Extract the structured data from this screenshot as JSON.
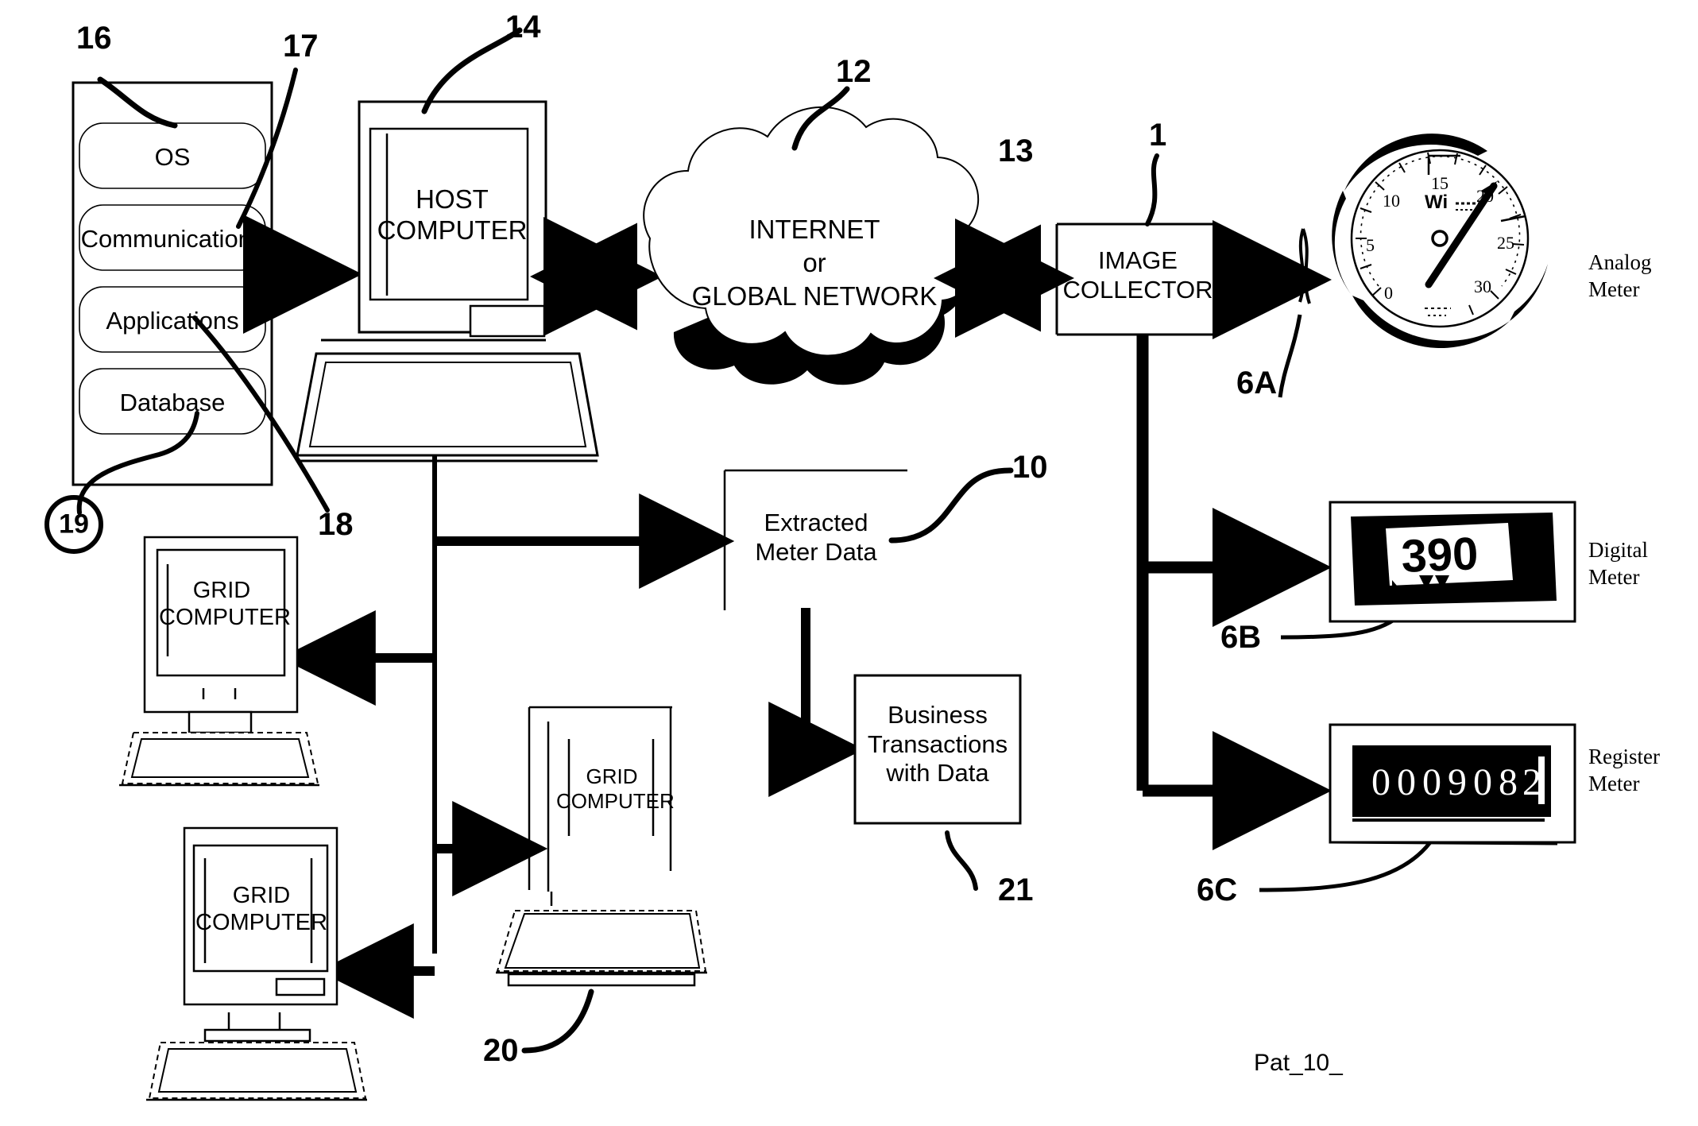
{
  "figure": {
    "caption": "Pat_10_",
    "background": "#ffffff",
    "ink": "#000000"
  },
  "software_stack": {
    "name": "software-stack-container",
    "items": [
      {
        "label": "OS"
      },
      {
        "label": "Communications"
      },
      {
        "label": "Applications"
      },
      {
        "label": "Database"
      }
    ],
    "ref_container": "16",
    "ref_stack_edge": "17",
    "ref_applications": "18",
    "ref_database": "19"
  },
  "host_computer": {
    "label": "HOST\nCOMPUTER",
    "ref": "14"
  },
  "network_cloud": {
    "line1": "INTERNET",
    "line2": "or",
    "line3": "GLOBAL NETWORK",
    "ref": "12"
  },
  "image_collector": {
    "label": "IMAGE\nCOLLECTOR",
    "ref": "1",
    "ref_incoming_link": "13"
  },
  "meters": [
    {
      "name": "analog-meter",
      "label": "Analog\nMeter",
      "ref": "6A",
      "reading": "20",
      "ticks": [
        "0",
        "5",
        "10",
        "15",
        "20",
        "25",
        "30"
      ],
      "brand": "Wi"
    },
    {
      "name": "digital-meter",
      "label": "Digital\nMeter",
      "ref": "6B",
      "reading": "390"
    },
    {
      "name": "register-meter",
      "label": "Register\nMeter",
      "ref": "6C",
      "reading": "000908"
    }
  ],
  "extracted_meter_data": {
    "label": "Extracted\nMeter Data",
    "ref": "10"
  },
  "business_transactions": {
    "label": "Business\nTransactions\nwith Data",
    "ref": "21"
  },
  "grid_computers": [
    {
      "name": "grid-computer-upper-left",
      "label": "GRID\nCOMPUTER"
    },
    {
      "name": "grid-computer-lower-left",
      "label": "GRID\nCOMPUTER"
    },
    {
      "name": "grid-computer-center",
      "label": "GRID\nCOMPUTER",
      "ref": "20"
    }
  ]
}
